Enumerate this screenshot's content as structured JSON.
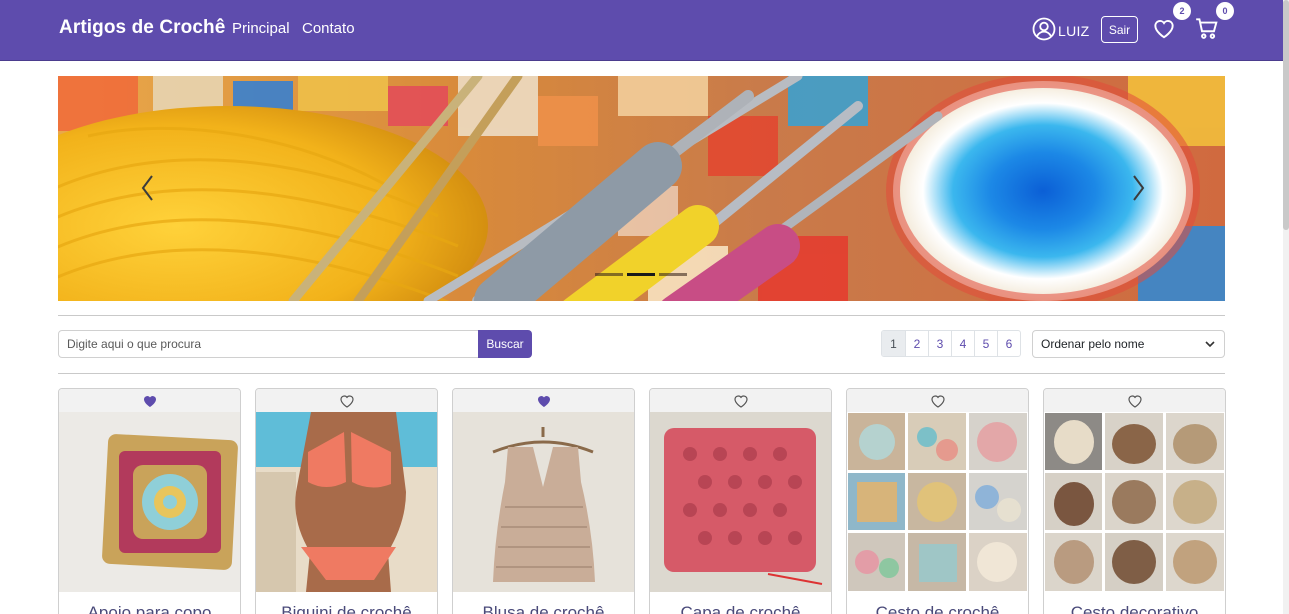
{
  "navbar": {
    "brand": "Artigos de Crochê",
    "links": [
      "Principal",
      "Contato"
    ],
    "user_name": "LUIZ",
    "logout_label": "Sair",
    "favorites_count": "2",
    "cart_count": "0",
    "icons": {
      "user": "user-circle-icon",
      "favorites": "heart-outline-icon",
      "cart": "cart-icon"
    },
    "color": "#5e4cad"
  },
  "carousel": {
    "icons": {
      "prev": "chevron-left-icon",
      "next": "chevron-right-icon"
    },
    "slide_count": 3,
    "active_index": 1
  },
  "search": {
    "placeholder": "Digite aqui o que procura",
    "value": "",
    "button_label": "Buscar"
  },
  "pagination": {
    "pages": [
      "1",
      "2",
      "3",
      "4",
      "5",
      "6"
    ],
    "current": "1"
  },
  "sort": {
    "selected": "Ordenar pelo nome",
    "icon": "chevron-down-icon"
  },
  "products": [
    {
      "title": "Apoio para copo",
      "favorited": true
    },
    {
      "title": "Biquini de crochê",
      "favorited": false
    },
    {
      "title": "Blusa de crochê",
      "favorited": true
    },
    {
      "title": "Capa de crochê",
      "favorited": false
    },
    {
      "title": "Cesto de crochê",
      "favorited": false
    },
    {
      "title": "Cesto decorativo",
      "favorited": false
    }
  ]
}
